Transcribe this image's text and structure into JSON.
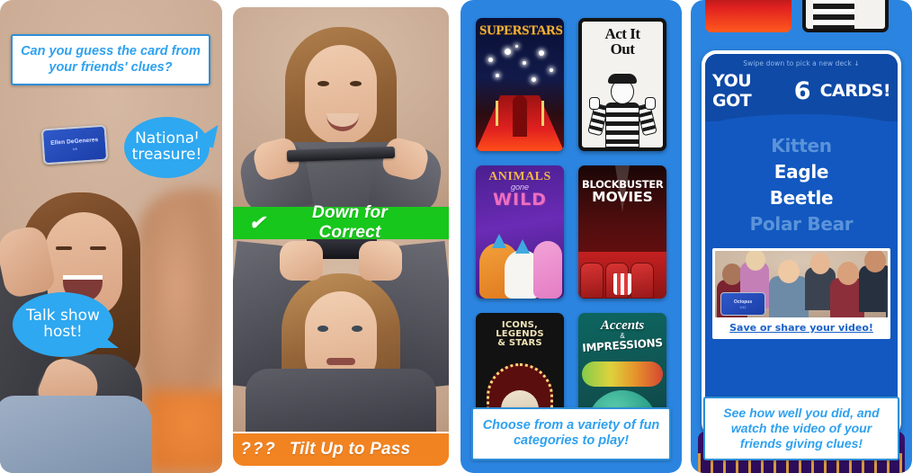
{
  "panel1": {
    "caption": "Can you guess the card from your friends' clues?",
    "card": {
      "name": "Ellen DeGeneres",
      "subtitle": "tvh"
    },
    "bubbles": [
      {
        "id": "national",
        "text": "National treasure!"
      },
      {
        "id": "talk",
        "text": "Talk show host!"
      }
    ]
  },
  "panel2": {
    "status_correct": {
      "icon": "check-icon",
      "icon_glyph": "✔",
      "label": "Down for Correct"
    },
    "status_pass": {
      "icon": "question-marks-icon",
      "icon_glyph": "? ? ?",
      "label": "Tilt Up to Pass"
    }
  },
  "panel3": {
    "caption": "Choose from a variety of fun categories to play!",
    "decks": [
      {
        "id": "superstars",
        "title": "SUPERSTARS"
      },
      {
        "id": "act-it-out",
        "title_line1": "Act It",
        "title_line2": "Out"
      },
      {
        "id": "animals-gone-wild",
        "title_line1": "ANIMALS",
        "title_line2": "gone",
        "title_line3": "WILD"
      },
      {
        "id": "blockbuster-movies",
        "title_line1": "BLOCKBUSTER",
        "title_line2": "MOVIES"
      },
      {
        "id": "icons-legends-stars",
        "title_line1": "ICONS, LEGENDS",
        "title_line2": "& STARS"
      },
      {
        "id": "accents-impressions",
        "title_line1": "Accents",
        "title_amp": "&",
        "title_line2": "IMPRESSIONS"
      }
    ]
  },
  "panel4": {
    "swipe_hint": "Swipe down to pick a new deck ↓",
    "score_prefix": "YOU GOT",
    "score_number": "6",
    "score_suffix": "CARDS!",
    "results": [
      {
        "word": "Kitten",
        "state": "dim"
      },
      {
        "word": "Eagle",
        "state": "bright"
      },
      {
        "word": "Beetle",
        "state": "bright"
      },
      {
        "word": "Polar Bear",
        "state": "dim"
      }
    ],
    "video_card": {
      "name": "Octopus",
      "subtitle": "0:42"
    },
    "share_link": "Save or share your video!",
    "caption": "See how well you did, and watch the video of your friends giving clues!"
  },
  "colors": {
    "panel_blue": "#2b84e0",
    "screen_blue": "#1258c0",
    "header_blue": "#0f4aa6",
    "caption_text": "#2fa1ef",
    "caption_border": "#2e8fd6",
    "bubble_blue": "#2ea8f0",
    "correct_green": "#18c71b",
    "pass_orange": "#f28321",
    "link_blue": "#1a61c9"
  }
}
